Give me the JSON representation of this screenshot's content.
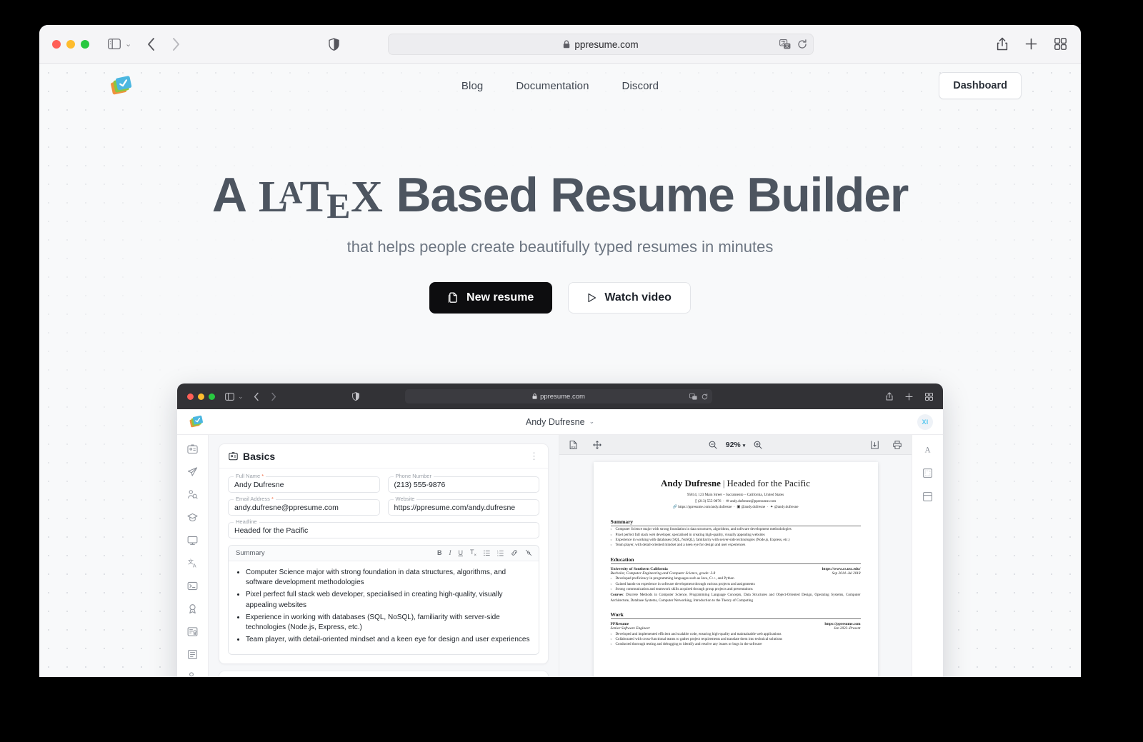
{
  "browser": {
    "url": "ppresume.com",
    "lock_icon": "lock-icon",
    "shield_icon": "shield-icon",
    "sidebar_icon": "sidebar-toggle-icon",
    "back_icon": "chevron-left-icon",
    "forward_icon": "chevron-right-icon",
    "translate_icon": "translate-icon",
    "reload_icon": "reload-icon",
    "share_icon": "share-icon",
    "newtab_icon": "plus-icon",
    "tabs_icon": "tab-overview-icon"
  },
  "site": {
    "logo": "ppresume-logo",
    "nav": [
      {
        "label": "Blog"
      },
      {
        "label": "Documentation"
      },
      {
        "label": "Discord"
      }
    ],
    "dashboard_label": "Dashboard"
  },
  "hero": {
    "title_before": "A ",
    "latex": {
      "l": "L",
      "a": "A",
      "t": "T",
      "e": "E",
      "x": "X"
    },
    "title_after": " Based Resume Builder",
    "subtitle": "that helps people create beautifully typed resumes in minutes",
    "primary_label": "New resume",
    "primary_icon": "copy-icon",
    "secondary_label": "Watch video",
    "secondary_icon": "play-triangle-icon"
  },
  "app": {
    "url": "ppresume.com",
    "doc_title": "Andy Dufresne",
    "doc_chevron": "chevron-down-icon",
    "avatar_initials": "XI",
    "rail_icons": [
      "basics-badge-icon",
      "location-paper-plane-icon",
      "profiles-person-search-icon",
      "education-graduation-cap-icon",
      "work-monitor-icon",
      "languages-translate-icon",
      "skills-terminal-icon",
      "awards-medal-icon",
      "certificates-icon",
      "publications-document-icon",
      "references-person-add-icon"
    ],
    "rail_right_icons": [
      "typography-letter-icon",
      "layout-margin-icon",
      "page-settings-icon"
    ],
    "basics": {
      "section_icon": "id-card-icon",
      "section_title": "Basics",
      "menu_icon": "kebab-menu-icon",
      "fields": [
        {
          "label": "Full Name",
          "required": true,
          "value": "Andy Dufresne"
        },
        {
          "label": "Phone Number",
          "required": false,
          "value": "(213) 555-9876"
        },
        {
          "label": "Email Address",
          "required": true,
          "value": "andy.dufresne@ppresume.com"
        },
        {
          "label": "Website",
          "required": false,
          "value": "https://ppresume.com/andy.dufresne"
        },
        {
          "label": "Headline",
          "required": false,
          "value": "Headed for the Pacific"
        }
      ],
      "summary_label": "Summary",
      "toolbar": [
        "B",
        "I",
        "U",
        "T",
        "list-bullet-icon",
        "list-ordered-icon",
        "link-icon",
        "unlink-icon"
      ],
      "summary_items": [
        "Computer Science major with strong foundation in data structures, algorithms, and software development methodologies",
        "Pixel perfect full stack web developer, specialised in creating high-quality, visually appealing websites",
        "Experience in working with databases (SQL, NoSQL), familiarity with server-side technologies (Node.js, Express, etc.)",
        "Team player, with detail-oriented mindset and a keen eye for design and user experiences"
      ]
    },
    "pdf": {
      "file_icon": "pdf-file-icon",
      "pan_icon": "move-icon",
      "zoom_out_icon": "zoom-out-icon",
      "zoom_level": "92%",
      "zoom_chevron": "chevron-down-icon",
      "zoom_in_icon": "zoom-in-icon",
      "download_icon": "download-icon",
      "print_icon": "print-icon"
    },
    "resume": {
      "name": "Andy Dufresne",
      "separator": "|",
      "headline": "Headed for the Pacific",
      "address": "95814, 123 Main Street – Sacramento – California, United States",
      "phone": "(213) 555-9876",
      "email": "andy.dufresne@ppresume.com",
      "website": "https://ppresume.com/andy.dufresne",
      "social1": "@andy.dufresne",
      "social2": "@andy.dufresne",
      "summary_heading": "Summary",
      "summary_items": [
        "Computer Science major with strong foundation in data structures, algorithms, and software development methodologies",
        "Pixel perfect full stack web developer, specialised in creating high-quality, visually appealing websites",
        "Experience in working with databases (SQL, NoSQL), familiarity with server-side technologies (Node.js, Express, etc.)",
        "Team player, with detail-oriented mindset and a keen eye for design and user experiences"
      ],
      "education_heading": "Education",
      "education": {
        "school": "University of Southern California",
        "link": "https://www.cs.usc.edu/",
        "degree": "Bachelor, Computer Engineering and Computer Science, grade: 3.8",
        "dates": "Sep 2014–Jul 2018",
        "bullets": [
          "Developed proficiency in programming languages such as Java, C++, and Python",
          "Gained hands-on experience in software development through various projects and assignments",
          "Strong communication and teamwork skills acquired through group projects and presentations"
        ],
        "courses_label": "Courses",
        "courses": "Discrete Methods in Computer Science, Programming Language Concepts, Data Structures and Object-Oriented Design, Operating Systems, Computer Architecture, Database Systems, Computer Networking, Introduction to the Theory of Computing"
      },
      "work_heading": "Work",
      "work": {
        "company": "PPResume",
        "link": "https://ppresume.com",
        "role": "Senior Software Engineer",
        "dates": "Jan 2023–Present",
        "bullets": [
          "Developed and implemented efficient and scalable code, ensuring high-quality and maintainable web applications",
          "Collaborated with cross-functional teams to gather project requirements and translate them into technical solutions",
          "Conducted thorough testing and debugging to identify and resolve any issues or bugs in the software"
        ]
      }
    }
  }
}
